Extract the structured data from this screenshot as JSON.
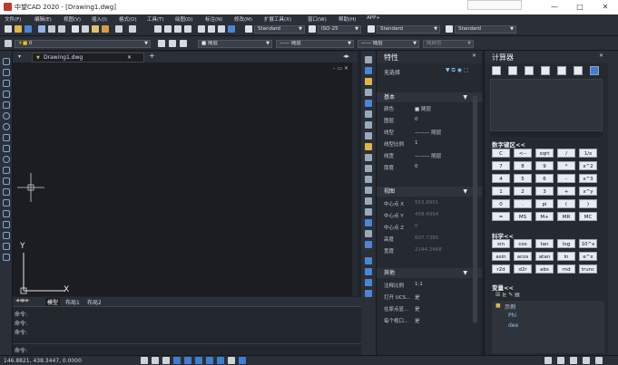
{
  "window": {
    "title": "中望CAD 2020 - [Drawing1.dwg]",
    "minimize": "—",
    "maximize": "□",
    "close": "✕"
  },
  "menu": [
    "文件(F)",
    "编辑(E)",
    "视图(V)",
    "插入(I)",
    "格式(O)",
    "工具(T)",
    "绘图(D)",
    "标注(N)",
    "修改(M)",
    "扩展工具(X)",
    "窗口(W)",
    "帮助(H)",
    "APP+"
  ],
  "toolbar1": {
    "textstyle": "Standard",
    "dimstyle": "ISO-25",
    "tablestyle": "Standard",
    "multileader": "Standard"
  },
  "toolbar2": {
    "layer": "0",
    "color": "随层",
    "linetype": "—— 随层",
    "lineweight": "—— 随层",
    "plotstyle": "随颜色"
  },
  "doc_tab": {
    "label": "Drawing1.dwg",
    "close": "✕",
    "add": "+"
  },
  "ucs": {
    "x": "X",
    "y": "Y"
  },
  "layout_tabs": [
    "模型",
    "布局1",
    "布局2"
  ],
  "command": {
    "history": [
      "命令:",
      "命令:",
      "命令:"
    ],
    "prompt": "命令:"
  },
  "status": {
    "coords": "146.8821, 438.3447, 0.0000"
  },
  "properties": {
    "title": "特性",
    "selection": "无选择",
    "sections": [
      {
        "name": "基本",
        "rows": [
          [
            "颜色",
            "■ 随层"
          ],
          [
            "图层",
            "0"
          ],
          [
            "线型",
            "——— 随层"
          ],
          [
            "线型比例",
            "1"
          ],
          [
            "线宽",
            "——— 随层"
          ],
          [
            "厚度",
            "0"
          ]
        ]
      },
      {
        "name": "视图",
        "rows": [
          [
            "中心点 X",
            "553.8901"
          ],
          [
            "中心点 Y",
            "458.4994"
          ],
          [
            "中心点 Z",
            "0"
          ],
          [
            "高度",
            "607.7385"
          ],
          [
            "宽度",
            "2144.2468"
          ]
        ]
      },
      {
        "name": "其他",
        "rows": [
          [
            "注释比例",
            "1:1"
          ],
          [
            "打开 UCS...",
            "是"
          ],
          [
            "在原点显...",
            "是"
          ],
          [
            "每个视口...",
            "是"
          ]
        ]
      }
    ]
  },
  "calculator": {
    "title": "计算器",
    "numpad_title": "数字键区<<",
    "sci_title": "科学<<",
    "var_title": "变量<<",
    "numpad": [
      [
        "C",
        "<--",
        "sqrt",
        "/",
        "1/x"
      ],
      [
        "7",
        "8",
        "9",
        "*",
        "x^2"
      ],
      [
        "4",
        "5",
        "6",
        "-",
        "x^3"
      ],
      [
        "1",
        "2",
        "3",
        "+",
        "x^y"
      ],
      [
        "0",
        ".",
        "pi",
        "(",
        ")"
      ],
      [
        "=",
        "MS",
        "M+",
        "MR",
        "MC"
      ]
    ],
    "sci": [
      [
        "sin",
        "cos",
        "tan",
        "log",
        "10^x"
      ],
      [
        "asin",
        "acos",
        "atan",
        "ln",
        "e^x"
      ],
      [
        "r2d",
        "d2r",
        "abs",
        "rnd",
        "trunc"
      ]
    ],
    "vars": {
      "group": "示例",
      "items": [
        "Phi",
        "dee"
      ]
    }
  },
  "colors": {
    "accent": "#3d7fd1",
    "canvas": "#1b1d22",
    "panel": "#252930"
  }
}
